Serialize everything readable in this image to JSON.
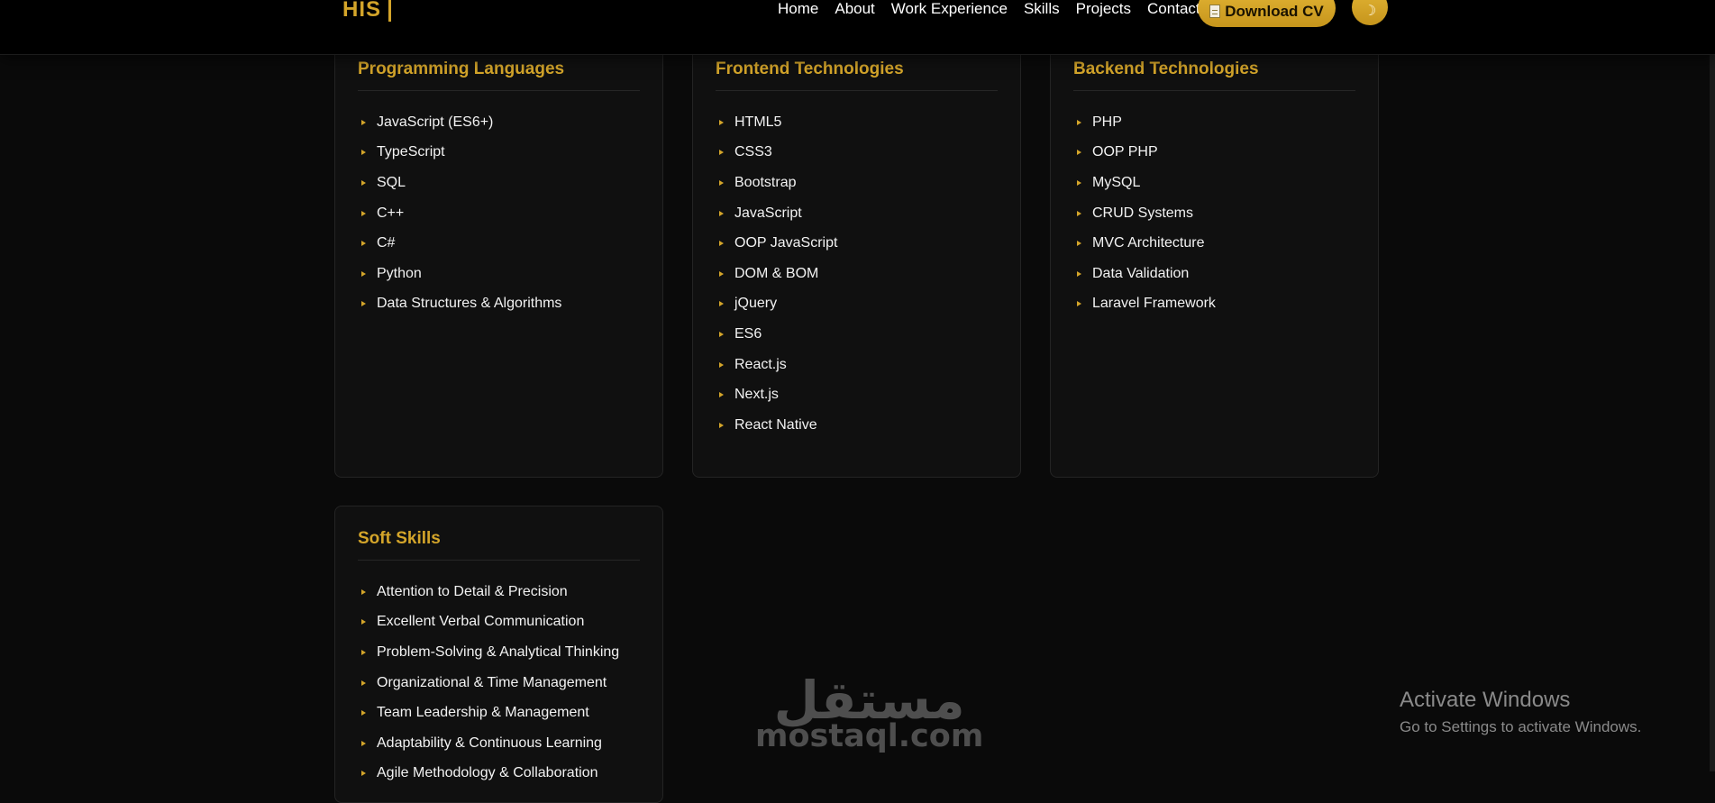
{
  "navbar": {
    "logo": "HIS",
    "links": [
      "Home",
      "About",
      "Work Experience",
      "Skills",
      "Projects",
      "Contact"
    ],
    "download_label": "Download CV",
    "theme_toggle_glyph": "☽"
  },
  "cards": [
    {
      "title": "Programming Languages",
      "items": [
        "JavaScript (ES6+)",
        "TypeScript",
        "SQL",
        "C++",
        "C#",
        "Python",
        "Data Structures & Algorithms"
      ]
    },
    {
      "title": "Frontend Technologies",
      "items": [
        "HTML5",
        "CSS3",
        "Bootstrap",
        "JavaScript",
        "OOP JavaScript",
        "DOM & BOM",
        "jQuery",
        "ES6",
        "React.js",
        "Next.js",
        "React Native"
      ]
    },
    {
      "title": "Backend Technologies",
      "items": [
        "PHP",
        "OOP PHP",
        "MySQL",
        "CRUD Systems",
        "MVC Architecture",
        "Data Validation",
        "Laravel Framework"
      ]
    },
    {
      "title": "Soft Skills",
      "items": [
        "Attention to Detail & Precision",
        "Excellent Verbal Communication",
        "Problem-Solving & Analytical Thinking",
        "Organizational & Time Management",
        "Team Leadership & Management",
        "Adaptability & Continuous Learning",
        "Agile Methodology & Collaboration"
      ]
    }
  ],
  "watermark": {
    "arabic": "مستقل",
    "latin": "mostaql.com"
  },
  "windows_activation": {
    "title": "Activate Windows",
    "subtitle": "Go to Settings to activate Windows."
  },
  "colors": {
    "accent": "#d4a52a",
    "background": "#0a0a0a",
    "card": "#101010"
  }
}
